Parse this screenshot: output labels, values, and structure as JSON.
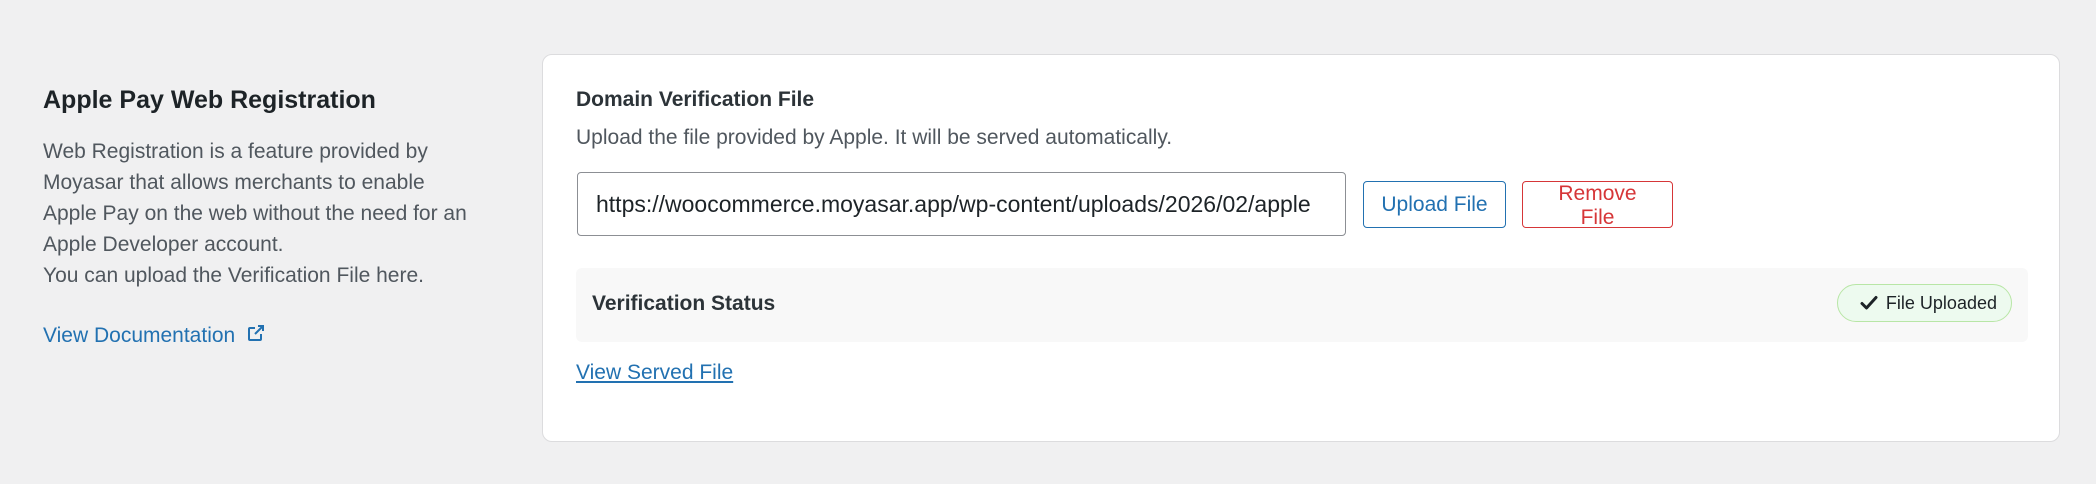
{
  "section": {
    "title": "Apple Pay Web Registration",
    "description_lines": [
      "Web Registration is a feature provided by",
      "Moyasar that allows merchants to enable",
      "Apple Pay on the web without the need for an",
      "Apple Developer account.",
      "You can upload the Verification File here."
    ],
    "doc_link_label": "View Documentation"
  },
  "card": {
    "field_title": "Domain Verification File",
    "field_help": "Upload the file provided by Apple. It will be served automatically.",
    "file_url": "https://woocommerce.moyasar.app/wp-content/uploads/2026/02/apple",
    "upload_label": "Upload File",
    "remove_label": "Remove File",
    "status_label": "Verification Status",
    "status_badge": "File Uploaded",
    "served_link_label": "View Served File"
  },
  "colors": {
    "link": "#2271b1",
    "danger": "#d63638",
    "success_bg": "#edfaef",
    "success_border": "#b8e6a6"
  },
  "icons": {
    "doc_link": "external-link-icon",
    "badge": "checkmark-icon"
  }
}
